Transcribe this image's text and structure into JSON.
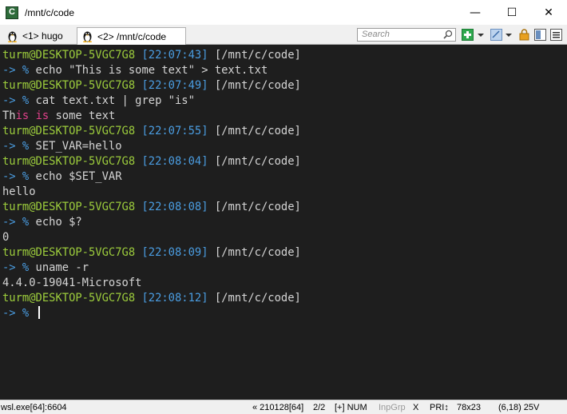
{
  "window": {
    "title": "/mnt/c/code",
    "app_icon_glyph": "C",
    "controls": {
      "minimize": "—",
      "maximize": "☐",
      "close": "✕"
    }
  },
  "tabs": [
    {
      "label": "<1> hugo",
      "active": false,
      "icon": "tux-icon"
    },
    {
      "label": "<2> /mnt/c/code",
      "active": true,
      "icon": "tux-icon"
    }
  ],
  "toolbar": {
    "search_placeholder": "Search"
  },
  "terminal": {
    "lines": [
      {
        "type": "prompt",
        "user": "turm@DESKTOP-5VGC7G8",
        "time": "[22:07:43]",
        "path": "[/mnt/c/code]"
      },
      {
        "type": "cmd",
        "arrow": "-> %",
        "text": "echo \"This is some text\" > text.txt"
      },
      {
        "type": "prompt",
        "user": "turm@DESKTOP-5VGC7G8",
        "time": "[22:07:49]",
        "path": "[/mnt/c/code]"
      },
      {
        "type": "cmd",
        "arrow": "-> %",
        "text": "cat text.txt | grep \"is\""
      },
      {
        "type": "grep",
        "parts": [
          "Th",
          "is",
          " ",
          "is",
          " some text"
        ]
      },
      {
        "type": "prompt",
        "user": "turm@DESKTOP-5VGC7G8",
        "time": "[22:07:55]",
        "path": "[/mnt/c/code]"
      },
      {
        "type": "cmd",
        "arrow": "-> %",
        "text": "SET_VAR=hello"
      },
      {
        "type": "prompt",
        "user": "turm@DESKTOP-5VGC7G8",
        "time": "[22:08:04]",
        "path": "[/mnt/c/code]"
      },
      {
        "type": "cmd",
        "arrow": "-> %",
        "text": "echo $SET_VAR"
      },
      {
        "type": "out",
        "text": "hello"
      },
      {
        "type": "prompt",
        "user": "turm@DESKTOP-5VGC7G8",
        "time": "[22:08:08]",
        "path": "[/mnt/c/code]"
      },
      {
        "type": "cmd",
        "arrow": "-> %",
        "text": "echo $?"
      },
      {
        "type": "out",
        "text": "0"
      },
      {
        "type": "prompt",
        "user": "turm@DESKTOP-5VGC7G8",
        "time": "[22:08:09]",
        "path": "[/mnt/c/code]"
      },
      {
        "type": "cmd",
        "arrow": "-> %",
        "text": "uname -r"
      },
      {
        "type": "out",
        "text": "4.4.0-19041-Microsoft"
      },
      {
        "type": "prompt",
        "user": "turm@DESKTOP-5VGC7G8",
        "time": "[22:08:12]",
        "path": "[/mnt/c/code]"
      },
      {
        "type": "cmd",
        "arrow": "-> %",
        "text": "",
        "cursor": true
      }
    ]
  },
  "statusbar": {
    "process": "wsl.exe[64]:6604",
    "buffer": "« 210128[64]",
    "console": "2/2",
    "mode": "[+] NUM",
    "inpgrp": "InpGrp",
    "x": "X",
    "pri": "PRI↕",
    "size": "78x23",
    "cursor_pos": "(6,18) 25V"
  },
  "colors": {
    "background": "#1e1e1e",
    "user": "#9ccc3c",
    "time": "#4a9ce0",
    "arrow": "#4a9ce0",
    "highlight": "#e0408a",
    "text": "#d4d4d4"
  }
}
